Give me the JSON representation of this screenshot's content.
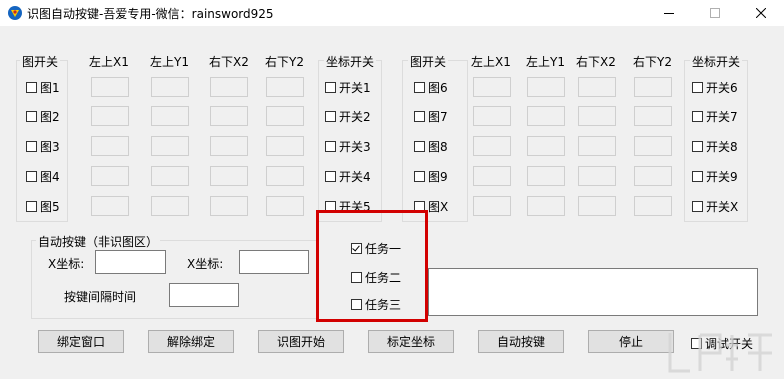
{
  "window": {
    "title": "识图自动按键-吾爱专用-微信：rainsword925",
    "min_icon": "minimize-icon",
    "max_icon": "maximize-icon",
    "close_icon": "close-icon"
  },
  "left_table": {
    "group_header": "图开关",
    "col_headers": [
      "左上X1",
      "左上Y1",
      "右下X2",
      "右下Y2"
    ],
    "coord_header": "坐标开关",
    "images": [
      "图1",
      "图2",
      "图3",
      "图4",
      "图5"
    ],
    "switches": [
      "开关1",
      "开关2",
      "开关3",
      "开关4",
      "开关5"
    ]
  },
  "right_table": {
    "group_header": "图开关",
    "col_headers": [
      "左上X1",
      "左上Y1",
      "右下X2",
      "右下Y2"
    ],
    "coord_header": "坐标开关",
    "images": [
      "图6",
      "图7",
      "图8",
      "图9",
      "图X"
    ],
    "switches": [
      "开关6",
      "开关7",
      "开关8",
      "开关9",
      "开关X"
    ]
  },
  "auto_key": {
    "group_label": "自动按键（非识图区）",
    "x_label": "X坐标:",
    "x_value": "",
    "y_label": "X坐标:",
    "y_value": "",
    "interval_label": "按键间隔时间",
    "interval_value": ""
  },
  "tasks": [
    {
      "label": "任务一",
      "checked": true
    },
    {
      "label": "任务二",
      "checked": false
    },
    {
      "label": "任务三",
      "checked": false
    }
  ],
  "buttons": {
    "bind_window": "绑定窗口",
    "unbind": "解除绑定",
    "start_recognition": "识图开始",
    "calibrate": "标定坐标",
    "auto_key": "自动按键",
    "stop": "停止"
  },
  "debug_switch": {
    "label": "调试开关",
    "checked": false
  },
  "colors": {
    "highlight_box": "#d20000",
    "title_bg": "#ffffff",
    "window_bg": "#f0f0f0"
  }
}
